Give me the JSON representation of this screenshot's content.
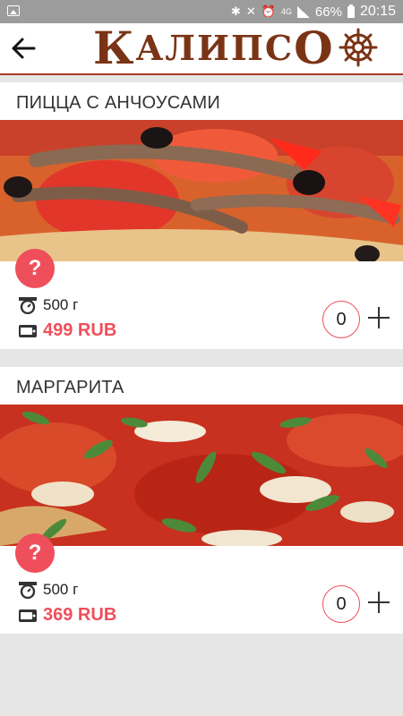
{
  "status_bar": {
    "battery_text": "66%",
    "time": "20:15",
    "network": "4G"
  },
  "header": {
    "logo_first_letter": "К",
    "logo_rest": "АЛИПС",
    "logo_last_letter": "О"
  },
  "products": [
    {
      "title": "ПИЦЦА С АНЧОУСАМИ",
      "weight": "500 г",
      "price": "499 RUB",
      "quantity": "0",
      "help_label": "?"
    },
    {
      "title": "МАРГАРИТА",
      "weight": "500 г",
      "price": "369 RUB",
      "quantity": "0",
      "help_label": "?"
    }
  ],
  "colors": {
    "accent": "#ef4f5b",
    "logo": "#7a3415",
    "header_line": "#a83a2b"
  }
}
